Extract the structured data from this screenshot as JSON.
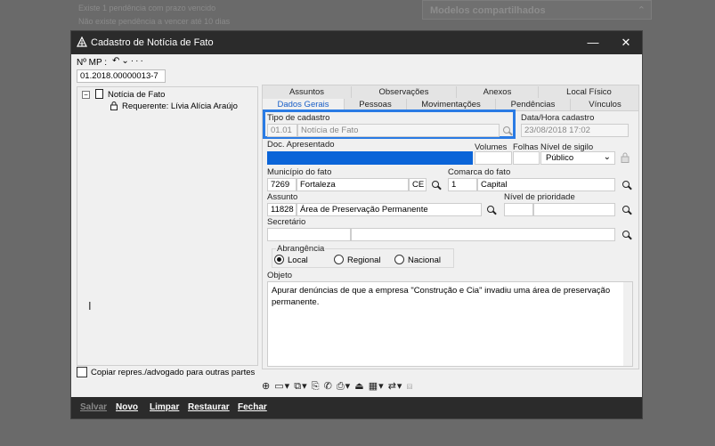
{
  "background": {
    "line1": "Existe 1 pendência com prazo vencido",
    "line2": "Não existe pendência a vencer até 10 dias",
    "panel_title": "Modelos compartilhados"
  },
  "dialog": {
    "title": "Cadastro de Notícia de Fato",
    "mp_label": "Nº MP :",
    "mp_value": "01.2018.00000013-7"
  },
  "tree": {
    "root": "Notícia de Fato",
    "child": "Requerente: Lívia Alícia Araújo"
  },
  "copy_option": "Copiar repres./advogado para outras partes",
  "tabs_row1": [
    "Assuntos",
    "Observações",
    "Anexos",
    "Local Físico"
  ],
  "tabs_row2": [
    "Dados Gerais",
    "Pessoas",
    "Movimentações",
    "Pendências",
    "Vínculos"
  ],
  "form": {
    "tipo_cadastro_label": "Tipo de cadastro",
    "tipo_cadastro_code": "01.01",
    "tipo_cadastro_value": "Notícia de Fato",
    "data_hora_label": "Data/Hora cadastro",
    "data_hora_value": "23/08/2018 17:02",
    "doc_label": "Doc. Apresentado",
    "volumes_label": "Volumes",
    "folhas_label": "Folhas",
    "sigilo_label": "Nível de sigilo",
    "sigilo_value": "Público",
    "municipio_label": "Município do fato",
    "municipio_code": "7269",
    "municipio_value": "Fortaleza",
    "municipio_uf": "CE",
    "comarca_label": "Comarca do fato",
    "comarca_code": "1",
    "comarca_value": "Capital",
    "assunto_label": "Assunto",
    "assunto_code": "11828",
    "assunto_value": "Área de Preservação Permanente",
    "prioridade_label": "Nível de prioridade",
    "secretario_label": "Secretário",
    "abrangencia_label": "Abrangência",
    "abrangencia_options": [
      "Local",
      "Regional",
      "Nacional"
    ],
    "abrangencia_selected": "Local",
    "objeto_label": "Objeto",
    "objeto_value": "Apurar denúncias de que a empresa \"Construção e Cia\" invadiu uma área de preservação permanente."
  },
  "footer": {
    "salvar": "Salvar",
    "novo": "Novo",
    "limpar": "Limpar",
    "restaurar": "Restaurar",
    "fechar": "Fechar"
  },
  "colors": {
    "highlight": "#2a7be4",
    "selected_field": "#0a64d8",
    "titlebar": "#2b2b2b"
  }
}
